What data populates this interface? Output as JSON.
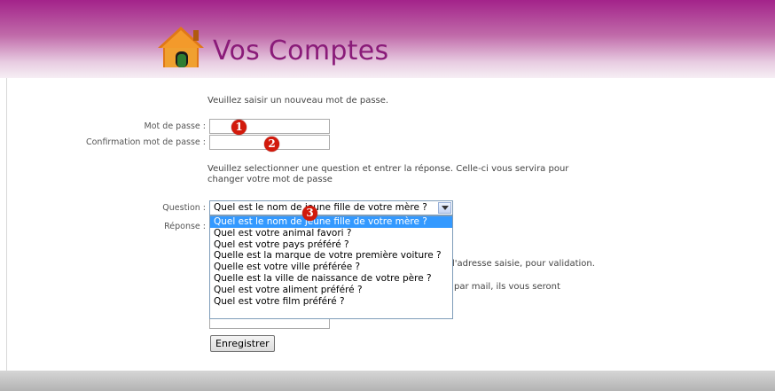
{
  "app": {
    "title": "Vos Comptes",
    "logo_icon": "house-icon"
  },
  "password_section": {
    "intro": "Veuillez saisir un nouveau mot de passe.",
    "password_label": "Mot de passe :",
    "password_value": "",
    "confirm_label": "Confirmation mot de passe :",
    "confirm_value": ""
  },
  "question_section": {
    "intro_line1": "Veuillez selectionner une question et entrer la réponse. Celle-ci vous servira pour",
    "intro_line2": "changer votre mot de passe",
    "question_label": "Question :",
    "answer_label": "Réponse :",
    "selected_question": "Quel est le nom de jeune fille de votre mère ?",
    "options": [
      "Quel est le nom de jeune fille de votre mère ?",
      "Quel est votre animal favori ?",
      "Quel est votre pays préféré ?",
      "Quelle est la marque de votre première voiture ?",
      "Quelle est votre ville préférée ?",
      "Quelle est la ville de naissance de votre père ?",
      "Quel est votre aliment préféré ?",
      "Quel est votre film préféré ?"
    ],
    "highlighted_option_index": 0
  },
  "partial_text": {
    "validation_tail": "l'adresse saisie, pour validation.",
    "mail_tail": "par mail, ils vous seront"
  },
  "markers": [
    "1",
    "2",
    "3"
  ],
  "submit_label": "Enregistrer",
  "colors": {
    "header_top": "#a3238a",
    "title": "#8a1b79",
    "marker": "#d21a0c",
    "selection": "#3399ff"
  }
}
